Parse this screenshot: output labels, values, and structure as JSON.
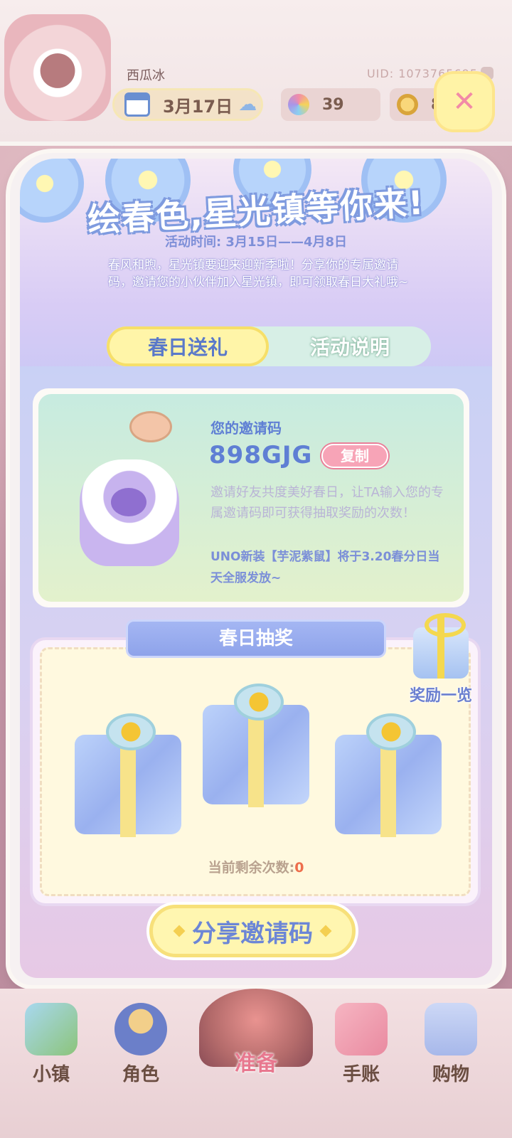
{
  "header": {
    "username": "西瓜冰",
    "uid": "UID: 1073765695",
    "date": "3月17日",
    "gems": "39",
    "coins": "8973"
  },
  "event": {
    "title": "绘春色,星光镇等你来!",
    "time": "活动时间: 3月15日——4月8日",
    "intro": "春风和煦，星光镇要迎来迎新季啦！分享你的专属邀请码，邀请您的小伙伴加入星光镇，即可领取春日大礼哦~",
    "close_icon": "close-icon"
  },
  "tabs": [
    {
      "label": "春日送礼",
      "active": true
    },
    {
      "label": "活动说明",
      "active": false
    }
  ],
  "invite": {
    "title": "您的邀请码",
    "code": "898GJG",
    "copy_label": "复制",
    "description": "邀请好友共度美好春日，让TA输入您的专属邀请码即可获得抽取奖励的次数！",
    "note": "UNO新装【芋泥紫鼠】将于3.20春分日当天全服发放~"
  },
  "lottery": {
    "title": "春日抽奖",
    "reward_list_label": "奖励一览",
    "remaining_label": "当前剩余次数:",
    "remaining_count": "0"
  },
  "share_button": "分享邀请码",
  "nav": [
    {
      "label": "小镇",
      "icon": "map-icon"
    },
    {
      "label": "角色",
      "icon": "character-icon"
    },
    {
      "label": "准备",
      "icon": "wardrobe-icon"
    },
    {
      "label": "手账",
      "icon": "journal-icon"
    },
    {
      "label": "购物",
      "icon": "shopping-bag-icon"
    }
  ]
}
